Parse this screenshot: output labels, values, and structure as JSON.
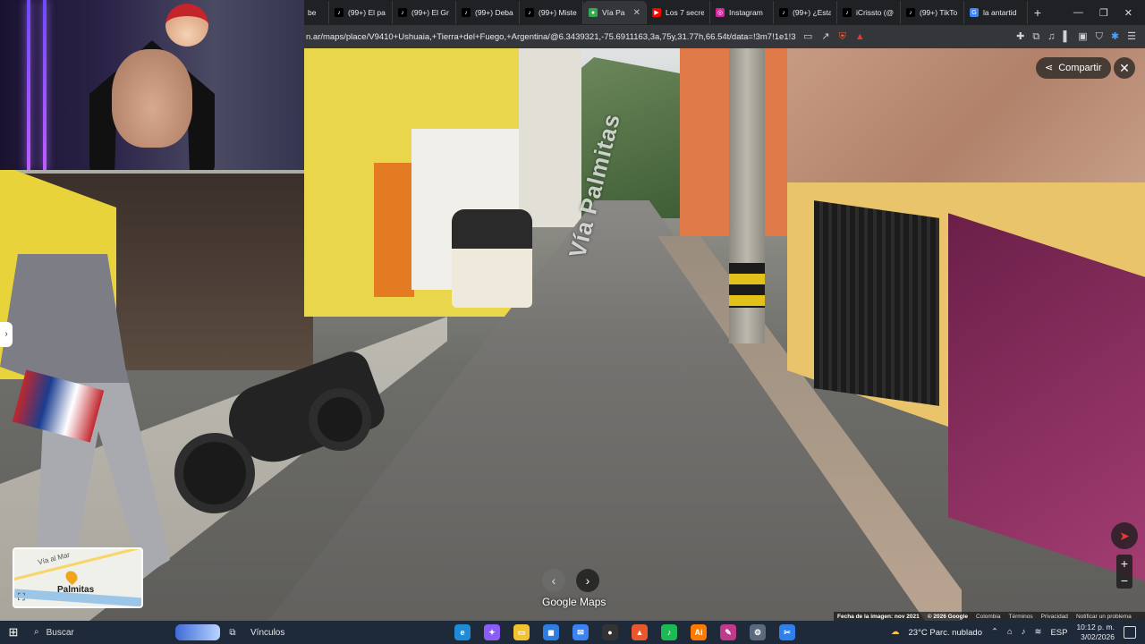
{
  "browser": {
    "tabs": [
      {
        "title": "(99+) El pa",
        "icon": "tiktok-icon",
        "active": false
      },
      {
        "title": "(99+) El Gr",
        "icon": "tiktok-icon",
        "active": false
      },
      {
        "title": "(99+) Deba",
        "icon": "tiktok-icon",
        "active": false
      },
      {
        "title": "(99+) Miste",
        "icon": "tiktok-icon",
        "active": false
      },
      {
        "title": "Vía Pa",
        "icon": "maps-pin-icon",
        "active": true
      },
      {
        "title": "Los 7 secre",
        "icon": "youtube-icon",
        "active": false
      },
      {
        "title": "Instagram",
        "icon": "instagram-icon",
        "active": false
      },
      {
        "title": "(99+) ¿Esta",
        "icon": "tiktok-icon",
        "active": false
      },
      {
        "title": "iCrissto (@",
        "icon": "tiktok-icon",
        "active": false
      },
      {
        "title": "(99+) TikTo",
        "icon": "tiktok-icon",
        "active": false
      },
      {
        "title": "la antartid",
        "icon": "google-icon",
        "active": false
      }
    ],
    "partial_tab": "be",
    "url": "n.ar/maps/place/V9410+Ushuaia,+Tierra+del+Fuego,+Argentina/@6.3439321,-75.6911163,3a,75y,31.77h,66.54t/data=!3m7!1e1!3m..."
  },
  "maps": {
    "share_label": "Compartir",
    "street_label": "Vía Palmitas",
    "minimap": {
      "road_label": "Vía al Mar",
      "place_label": "Palmitas"
    },
    "attribution": "Google Maps",
    "footer": {
      "image_date": "Fecha de la imagen: nov 2021",
      "copyright": "© 2026 Google",
      "country": "Colombia",
      "terms": "Términos",
      "privacy": "Privacidad",
      "report": "Notificar un problema"
    }
  },
  "taskbar": {
    "search_placeholder": "Buscar",
    "links_label": "Vínculos",
    "weather": "23°C  Parc. nublado",
    "lang": "ESP",
    "time": "10:12 p. m.",
    "date": "3/02/2026",
    "apps": [
      {
        "name": "edge-icon",
        "color": "#1f8ad6",
        "glyph": "e"
      },
      {
        "name": "copilot-icon",
        "color": "#8b5cf6",
        "glyph": "✦"
      },
      {
        "name": "file-explorer-icon",
        "color": "#f2c230",
        "glyph": "▭"
      },
      {
        "name": "store-icon",
        "color": "#2f7de1",
        "glyph": "◼"
      },
      {
        "name": "mail-icon",
        "color": "#3b82f6",
        "glyph": "✉"
      },
      {
        "name": "obs-icon",
        "color": "#333333",
        "glyph": "●"
      },
      {
        "name": "brave-icon",
        "color": "#e8582c",
        "glyph": "▲"
      },
      {
        "name": "spotify-icon",
        "color": "#1db954",
        "glyph": "♪"
      },
      {
        "name": "illustrator-icon",
        "color": "#ff7b00",
        "glyph": "Ai"
      },
      {
        "name": "paint-icon",
        "color": "#c03a8c",
        "glyph": "✎"
      },
      {
        "name": "settings-icon",
        "color": "#5b6b7f",
        "glyph": "⚙"
      },
      {
        "name": "snipping-tool-icon",
        "color": "#2f80ed",
        "glyph": "✂"
      }
    ]
  }
}
